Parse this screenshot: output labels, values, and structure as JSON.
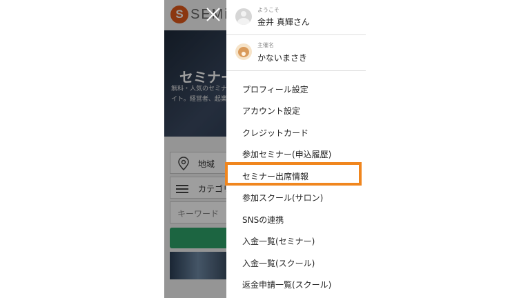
{
  "background_app": {
    "logo_letter": "S",
    "logo_text": "SEMi",
    "hero_title": "セミナー",
    "hero_sub": "無料・人気のセミナ イト。経営者、起業",
    "area_label": "地域",
    "category_label": "カテゴリ",
    "keyword_placeholder": "キーワード"
  },
  "drawer": {
    "greeting_label": "ようこそ",
    "user_name": "金井 真輝さん",
    "organizer_label": "主催名",
    "organizer_name": "かないまさき",
    "menu_items": [
      "プロフィール設定",
      "アカウント設定",
      "クレジットカード",
      "参加セミナー(申込履歴)",
      "セミナー出席情報",
      "参加スクール(サロン)",
      "SNSの連携",
      "入金一覧(セミナー)",
      "入金一覧(スクール)",
      "返金申請一覧(スクール)"
    ]
  },
  "colors": {
    "highlight": "#f0861e",
    "brand": "#e05a1a",
    "search_button": "#2ea36a"
  },
  "icons": {
    "close": "close-icon",
    "pin": "location-pin-icon",
    "category": "list-icon",
    "user": "user-avatar-icon",
    "organizer": "dog-avatar-icon"
  }
}
